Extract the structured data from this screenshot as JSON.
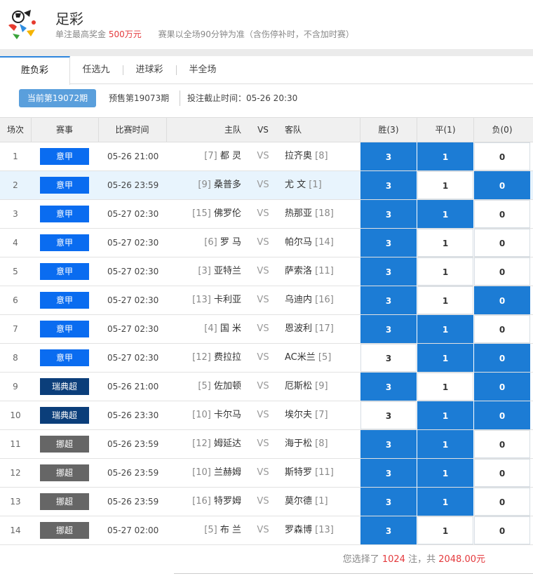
{
  "header": {
    "title": "足彩",
    "prize_label": "单注最高奖金",
    "prize_value": "500万元",
    "note": "赛果以全场90分钟为准（含伤停补时，不含加时赛）"
  },
  "tabs": [
    {
      "label": "胜负彩",
      "active": true
    },
    {
      "label": "任选九",
      "active": false
    },
    {
      "label": "进球彩",
      "active": false
    },
    {
      "label": "半全场",
      "active": false
    }
  ],
  "issue": {
    "current": "当前第19072期",
    "presale": "预售第19073期",
    "deadline": "投注截止时间：05-26 20:30"
  },
  "columns": {
    "no": "场次",
    "league": "赛事",
    "time": "比赛时间",
    "home": "主队",
    "vs": "VS",
    "away": "客队",
    "win": "胜(3)",
    "draw": "平(1)",
    "lose": "负(0)"
  },
  "league_colors": {
    "意甲": "#0a6cf0",
    "瑞典超": "#0b3e7a",
    "挪超": "#666666"
  },
  "colors": {
    "selected": "#1c7cd5",
    "prize": "#e4393c",
    "tab_accent": "#2e86de"
  },
  "matches": [
    {
      "no": "1",
      "league": "意甲",
      "time": "05-26 21:00",
      "home": "都 灵",
      "home_rank": "[7]",
      "vs": "VS",
      "away": "拉齐奥",
      "away_rank": "[8]",
      "win": "3",
      "draw": "1",
      "lose": "0",
      "sel": [
        true,
        true,
        false
      ],
      "highlight": false
    },
    {
      "no": "2",
      "league": "意甲",
      "time": "05-26 23:59",
      "home": "桑普多",
      "home_rank": "[9]",
      "vs": "VS",
      "away": "尤 文",
      "away_rank": "[1]",
      "win": "3",
      "draw": "1",
      "lose": "0",
      "sel": [
        true,
        false,
        true
      ],
      "highlight": true
    },
    {
      "no": "3",
      "league": "意甲",
      "time": "05-27 02:30",
      "home": "佛罗伦",
      "home_rank": "[15]",
      "vs": "VS",
      "away": "热那亚",
      "away_rank": "[18]",
      "win": "3",
      "draw": "1",
      "lose": "0",
      "sel": [
        true,
        true,
        false
      ],
      "highlight": false
    },
    {
      "no": "4",
      "league": "意甲",
      "time": "05-27 02:30",
      "home": "罗 马",
      "home_rank": "[6]",
      "vs": "VS",
      "away": "帕尔马",
      "away_rank": "[14]",
      "win": "3",
      "draw": "1",
      "lose": "0",
      "sel": [
        true,
        false,
        false
      ],
      "highlight": false
    },
    {
      "no": "5",
      "league": "意甲",
      "time": "05-27 02:30",
      "home": "亚特兰",
      "home_rank": "[3]",
      "vs": "VS",
      "away": "萨索洛",
      "away_rank": "[11]",
      "win": "3",
      "draw": "1",
      "lose": "0",
      "sel": [
        true,
        false,
        false
      ],
      "highlight": false
    },
    {
      "no": "6",
      "league": "意甲",
      "time": "05-27 02:30",
      "home": "卡利亚",
      "home_rank": "[13]",
      "vs": "VS",
      "away": "乌迪内",
      "away_rank": "[16]",
      "win": "3",
      "draw": "1",
      "lose": "0",
      "sel": [
        true,
        false,
        true
      ],
      "highlight": false
    },
    {
      "no": "7",
      "league": "意甲",
      "time": "05-27 02:30",
      "home": "国 米",
      "home_rank": "[4]",
      "vs": "VS",
      "away": "恩波利",
      "away_rank": "[17]",
      "win": "3",
      "draw": "1",
      "lose": "0",
      "sel": [
        true,
        true,
        false
      ],
      "highlight": false
    },
    {
      "no": "8",
      "league": "意甲",
      "time": "05-27 02:30",
      "home": "费拉拉",
      "home_rank": "[12]",
      "vs": "VS",
      "away": "AC米兰",
      "away_rank": "[5]",
      "win": "3",
      "draw": "1",
      "lose": "0",
      "sel": [
        false,
        true,
        true
      ],
      "highlight": false
    },
    {
      "no": "9",
      "league": "瑞典超",
      "time": "05-26 21:00",
      "home": "佐加顿",
      "home_rank": "[5]",
      "vs": "VS",
      "away": "厄斯松",
      "away_rank": "[9]",
      "win": "3",
      "draw": "1",
      "lose": "0",
      "sel": [
        true,
        false,
        true
      ],
      "highlight": false
    },
    {
      "no": "10",
      "league": "瑞典超",
      "time": "05-26 23:30",
      "home": "卡尔马",
      "home_rank": "[10]",
      "vs": "VS",
      "away": "埃尔夫",
      "away_rank": "[7]",
      "win": "3",
      "draw": "1",
      "lose": "0",
      "sel": [
        false,
        true,
        true
      ],
      "highlight": false
    },
    {
      "no": "11",
      "league": "挪超",
      "time": "05-26 23:59",
      "home": "姆延达",
      "home_rank": "[12]",
      "vs": "VS",
      "away": "海于松",
      "away_rank": "[8]",
      "win": "3",
      "draw": "1",
      "lose": "0",
      "sel": [
        true,
        true,
        false
      ],
      "highlight": false
    },
    {
      "no": "12",
      "league": "挪超",
      "time": "05-26 23:59",
      "home": "兰赫姆",
      "home_rank": "[10]",
      "vs": "VS",
      "away": "斯特罗",
      "away_rank": "[11]",
      "win": "3",
      "draw": "1",
      "lose": "0",
      "sel": [
        true,
        true,
        false
      ],
      "highlight": false
    },
    {
      "no": "13",
      "league": "挪超",
      "time": "05-26 23:59",
      "home": "特罗姆",
      "home_rank": "[16]",
      "vs": "VS",
      "away": "莫尔德",
      "away_rank": "[1]",
      "win": "3",
      "draw": "1",
      "lose": "0",
      "sel": [
        true,
        true,
        false
      ],
      "highlight": false
    },
    {
      "no": "14",
      "league": "挪超",
      "time": "05-27 02:00",
      "home": "布 兰",
      "home_rank": "[5]",
      "vs": "VS",
      "away": "罗森博",
      "away_rank": "[13]",
      "win": "3",
      "draw": "1",
      "lose": "0",
      "sel": [
        true,
        false,
        false
      ],
      "highlight": false
    }
  ],
  "summary": {
    "prefix": "您选择了",
    "count": "1024",
    "mid": "注，共",
    "amount": "2048.00元"
  }
}
